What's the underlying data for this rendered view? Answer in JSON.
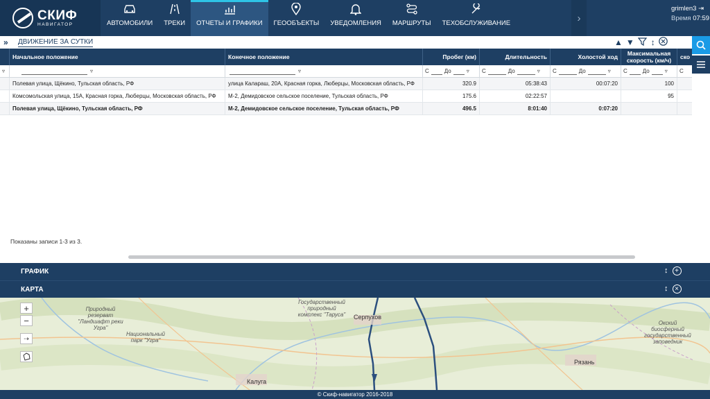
{
  "app": {
    "logo_title": "СКИФ",
    "logo_subtitle": "НАВИГАТОР",
    "user_name": "grimlen3",
    "time_label": "Время",
    "time_value": "07:59"
  },
  "nav": [
    {
      "label": "АВТОМОБИЛИ",
      "icon": "car-icon"
    },
    {
      "label": "ТРЕКИ",
      "icon": "road-icon"
    },
    {
      "label": "ОТЧЕТЫ И ГРАФИКИ",
      "icon": "chart-icon",
      "active": true
    },
    {
      "label": "ГЕООБЪЕКТЫ",
      "icon": "map-pin-icon"
    },
    {
      "label": "УВЕДОМЛЕНИЯ",
      "icon": "bell-icon"
    },
    {
      "label": "МАРШРУТЫ",
      "icon": "route-icon"
    },
    {
      "label": "ТЕХОБСЛУЖИВАНИЕ",
      "icon": "wrench-icon"
    }
  ],
  "panel": {
    "title": "ДВИЖЕНИЕ ЗА СУТКИ"
  },
  "table": {
    "headers": [
      "Начальное положение",
      "Конечное положение",
      "Пробег (км)",
      "Длительность",
      "Холостой ход",
      "Максимальная скорость (км/ч)",
      "ско"
    ],
    "filter_from": "С",
    "filter_to": "До",
    "rows": [
      [
        "Полевая улица, Щёкино, Тульская область, РФ",
        "улица Калараш, 20А, Красная горка, Люберцы, Московская область, РФ",
        "320.9",
        "05:38:43",
        "00:07:20",
        "100"
      ],
      [
        "Комсомольская улица, 15А, Красная горка, Люберцы, Московская область, РФ",
        "М-2, Демидовское сельское поселение, Тульская область, РФ",
        "175.6",
        "02:22:57",
        "",
        "95"
      ]
    ],
    "total": [
      "Полевая улица, Щёкино, Тульская область, РФ",
      "М-2, Демидовское сельское поселение, Тульская область, РФ",
      "496.5",
      "8:01:40",
      "0:07:20",
      ""
    ],
    "shown_text": "Показаны записи 1-3 из 3."
  },
  "bars": {
    "chart_label": "ГРАФИК",
    "map_label": "КАРТА"
  },
  "map": {
    "zoom_in": "+",
    "zoom_out": "−",
    "labels": [
      {
        "text": "Природный резерват \"Ландшафт реки Угра\""
      },
      {
        "text": "Национальный парк \"Угра\""
      },
      {
        "text": "Государственный природный комплекс \"Таруса\""
      },
      {
        "text": "Окский биосферный государственный заповедник"
      }
    ],
    "cities": [
      "Серпухов",
      "Калуга",
      "Рязань"
    ]
  },
  "footer": "© Скиф-навигатор 2016-2018"
}
